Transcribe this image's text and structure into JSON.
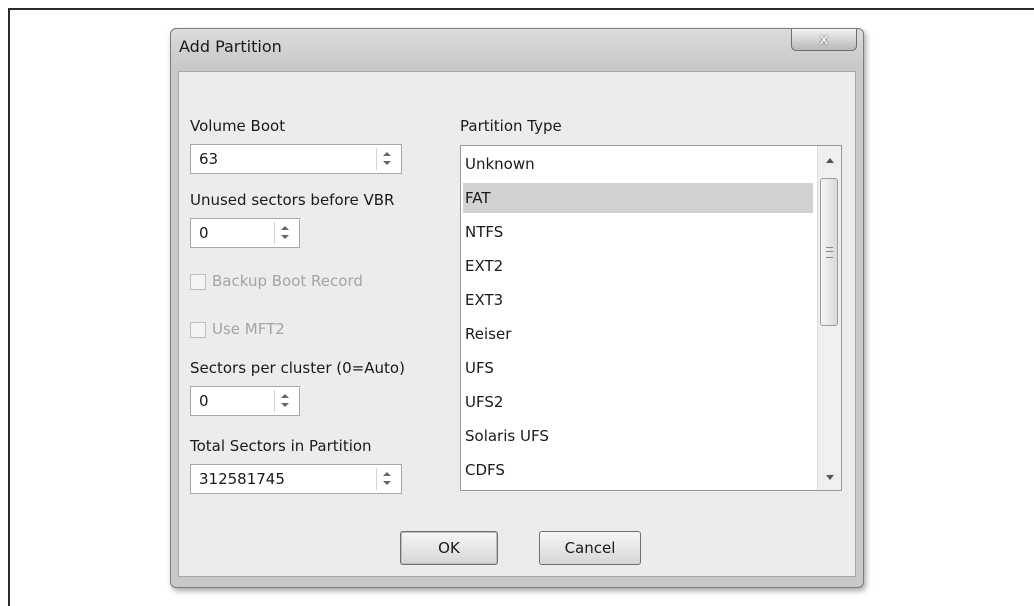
{
  "dialog": {
    "title": "Add Partition",
    "close_glyph": "x"
  },
  "fields": {
    "volume_boot": {
      "label": "Volume Boot",
      "value": "63"
    },
    "unused_sectors": {
      "label": "Unused sectors before VBR",
      "value": "0"
    },
    "backup_boot_record": {
      "label": "Backup Boot Record",
      "checked": false,
      "enabled": false
    },
    "use_mft2": {
      "label": "Use MFT2",
      "checked": false,
      "enabled": false
    },
    "sectors_per_cluster": {
      "label": "Sectors per cluster (0=Auto)",
      "value": "0"
    },
    "total_sectors": {
      "label": "Total Sectors in Partition",
      "value": "312581745"
    }
  },
  "partition_type": {
    "label": "Partition Type",
    "selected": "FAT",
    "items": [
      "Unknown",
      "FAT",
      "NTFS",
      "EXT2",
      "EXT3",
      "Reiser",
      "UFS",
      "UFS2",
      "Solaris UFS",
      "CDFS"
    ]
  },
  "buttons": {
    "ok": "OK",
    "cancel": "Cancel"
  },
  "icons": {
    "spin_up": "chevron-up-icon",
    "spin_down": "chevron-down-icon",
    "scroll_up": "scroll-up-icon",
    "scroll_down": "scroll-down-icon",
    "close": "close-icon"
  }
}
